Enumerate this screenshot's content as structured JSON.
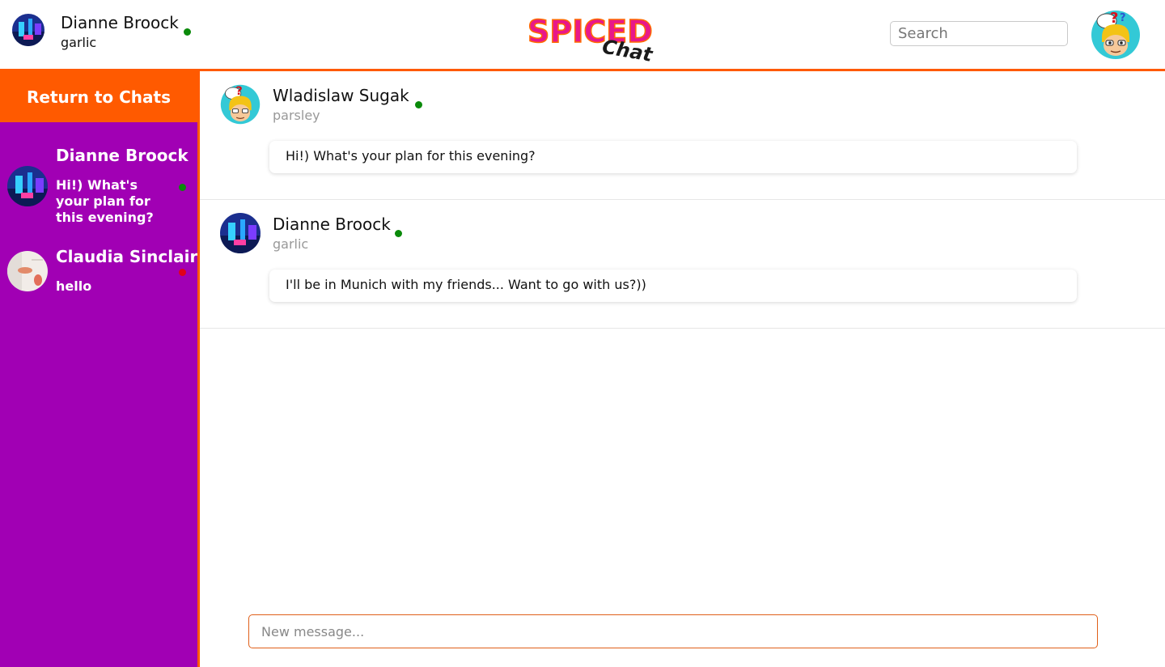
{
  "current_user": {
    "name": "Dianne Broock",
    "status_text": "garlic",
    "online_color": "#0a8a0a"
  },
  "logo": {
    "word": "SPICED",
    "sub": "Chat"
  },
  "search": {
    "placeholder": "Search",
    "value": ""
  },
  "profile": {
    "icon": "cartoon-avatar-icon"
  },
  "sidebar": {
    "return_label": "Return to Chats",
    "chats": [
      {
        "name": "Dianne Broock",
        "last_message": "Hi!) What's your plan for this evening?",
        "online": true,
        "status_color": "#0a8a0a"
      },
      {
        "name": "Claudia Sinclair",
        "last_message": "hello",
        "online": false,
        "status_color": "#e0001a"
      }
    ]
  },
  "messages": [
    {
      "sender": "Wladislaw Sugak",
      "sender_status": "parsley",
      "text": "Hi!) What's your plan for this evening?",
      "online": true
    },
    {
      "sender": "Dianne Broock",
      "sender_status": "garlic",
      "text": "I'll be in Munich with my friends... Want to go with us?))",
      "online": true
    }
  ],
  "composer": {
    "placeholder": "New message...",
    "value": ""
  },
  "colors": {
    "accent": "#ff5a00",
    "sidebar": "#a100b4",
    "online": "#0a8a0a",
    "offline": "#e0001a"
  }
}
